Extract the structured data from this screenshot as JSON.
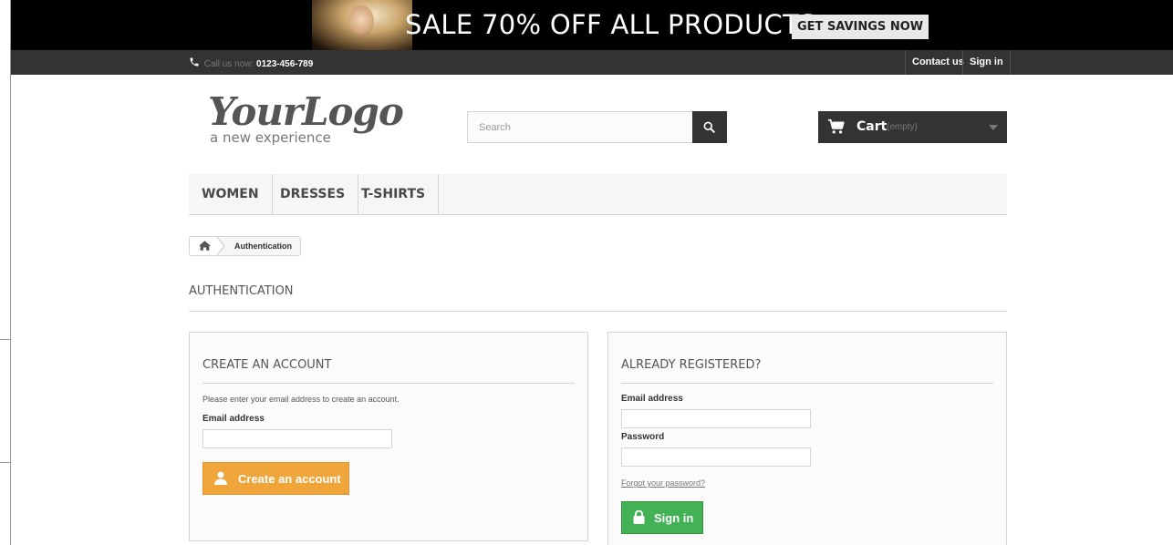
{
  "banner": {
    "headline": "SALE 70% OFF ALL PRODUCTS",
    "cta": "GET SAVINGS NOW"
  },
  "topbar": {
    "phone_prefix": "Call us now:",
    "phone_number": "0123-456-789",
    "contact": "Contact us",
    "signin": "Sign in"
  },
  "header": {
    "logo_main": "YourLogo",
    "logo_sub": "a new experience",
    "search_placeholder": "Search",
    "cart_label": "Cart",
    "cart_status": "(empty)"
  },
  "menu": {
    "items": [
      {
        "label": "WOMEN"
      },
      {
        "label": "DRESSES"
      },
      {
        "label": "T-SHIRTS"
      }
    ]
  },
  "breadcrumb": {
    "current": "Authentication"
  },
  "page": {
    "heading": "AUTHENTICATION"
  },
  "create_account": {
    "title": "CREATE AN ACCOUNT",
    "hint": "Please enter your email address to create an account.",
    "email_label": "Email address",
    "email_value": "",
    "button_label": "Create an account"
  },
  "login": {
    "title": "ALREADY REGISTERED?",
    "email_label": "Email address",
    "email_value": "",
    "password_label": "Password",
    "password_value": "",
    "forgot_label": "Forgot your password?",
    "button_label": "Sign in"
  },
  "colors": {
    "banner_bg": "#000000",
    "topbar_bg": "#333333",
    "create_button": "#f0a53b",
    "signin_button": "#43b155"
  }
}
